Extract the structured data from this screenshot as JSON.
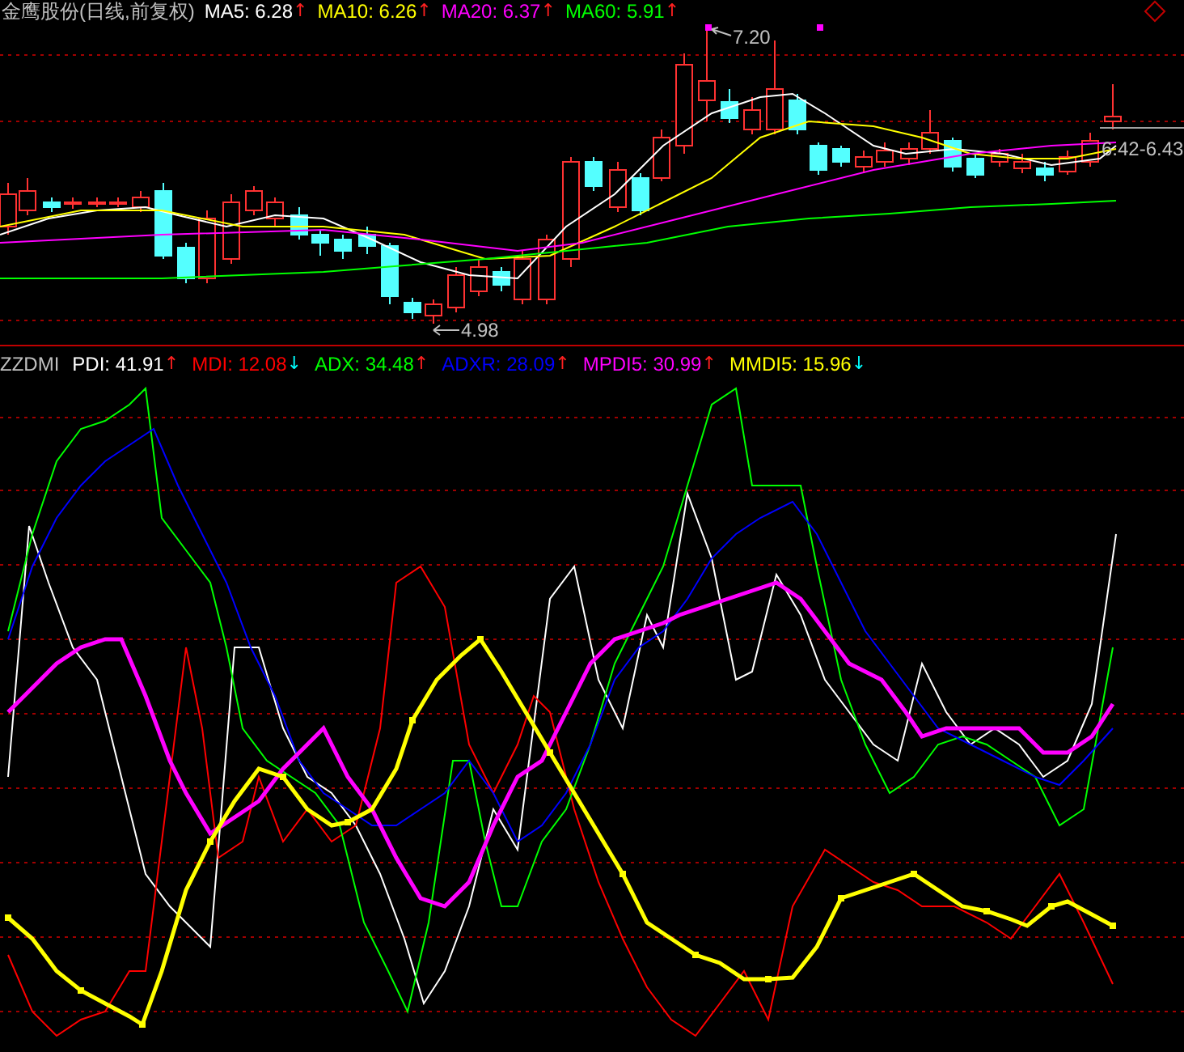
{
  "price_panel": {
    "title": "金鹰股份(日线,前复权)",
    "moving_averages": [
      {
        "label": "MA5: 6.28",
        "color": "#ffffff",
        "arrow": {
          "text": "↑",
          "color": "#ff2020"
        }
      },
      {
        "label": "MA10: 6.26",
        "color": "#ffff00",
        "arrow": {
          "text": "↑",
          "color": "#ff2020"
        }
      },
      {
        "label": "MA20: 6.37",
        "color": "#ff00ff",
        "arrow": {
          "text": "↑",
          "color": "#ff2020"
        }
      },
      {
        "label": "MA60: 5.91",
        "color": "#00ff00",
        "arrow": {
          "text": "↑",
          "color": "#ff2020"
        }
      }
    ],
    "high_label": "7.20",
    "low_label": "4.98",
    "last_label": "6.42-6.43"
  },
  "indicator_panel": {
    "name": "ZZDMI",
    "series": [
      {
        "label": "PDI: 41.91",
        "color": "#ffffff",
        "arrow": {
          "text": "↑",
          "color": "#ff2020"
        }
      },
      {
        "label": "MDI: 12.08",
        "color": "#ff0000",
        "arrow": {
          "text": "↓",
          "color": "#00ffff"
        }
      },
      {
        "label": "ADX: 34.48",
        "color": "#00ff00",
        "arrow": {
          "text": "↑",
          "color": "#ff2020"
        }
      },
      {
        "label": "ADXR: 28.09",
        "color": "#0000ff",
        "arrow": {
          "text": "↑",
          "color": "#ff2020"
        }
      },
      {
        "label": "MPDI5: 30.99",
        "color": "#ff00ff",
        "arrow": {
          "text": "↑",
          "color": "#ff2020"
        }
      },
      {
        "label": "MMDI5: 15.96",
        "color": "#ffff00",
        "arrow": {
          "text": "↓",
          "color": "#00ffff"
        }
      }
    ]
  }
}
